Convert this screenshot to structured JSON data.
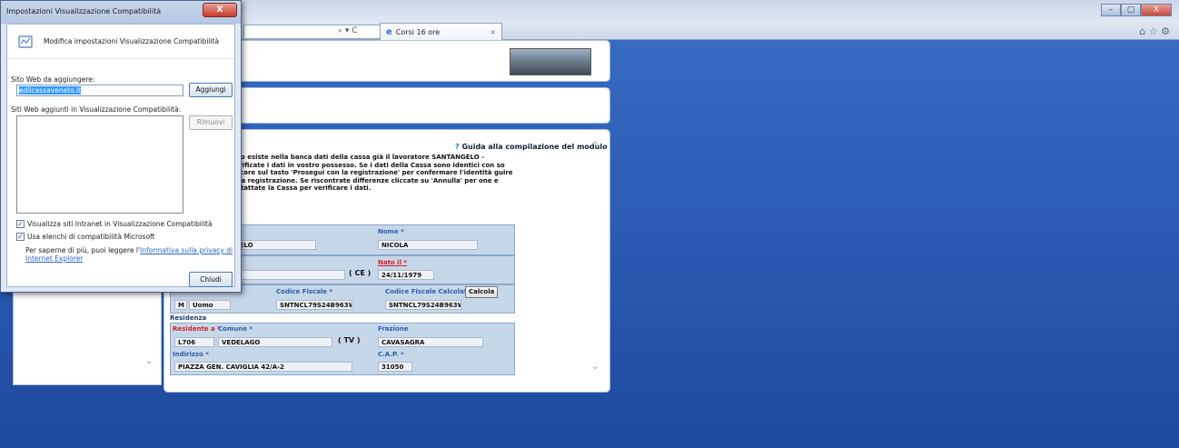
{
  "browser": {
    "tab_title": "Corsi 16 ore",
    "tab_close": "×",
    "address_tools": "⌕ ▾ C",
    "window_controls": {
      "minimize": "–",
      "maximize": "▢",
      "close": "X"
    },
    "right_icons": "⌂ ☆ ⚙"
  },
  "dialog": {
    "title": "Impostazioni Visualizzazione Compatibilità",
    "close_label": "X",
    "header_text": "Modifica impostazioni Visualizzazione Compatibilità",
    "site_to_add_label": "Sito Web da aggiungere:",
    "site_to_add_value": "edilcassaveneto.it",
    "add_button": "Aggiungi",
    "added_sites_label": "Siti Web aggiunti in Visualizzazione Compatibilità:",
    "remove_button": "Rimuovi",
    "checkbox_intranet": "Visualizza siti Intranet in Visualizzazione Compatibilità",
    "checkbox_microsoft": "Usa elenchi di compatibilità Microsoft",
    "privacy_prefix": "Per saperne di più, puoi leggere l'",
    "privacy_link": "Informativa sulla privacy di Internet Explorer",
    "close_button": "Chiudi"
  },
  "page": {
    "guide": "Guida alla compilazione del modulo",
    "message": "erito esiste nella banca dati della cassa già il lavoratore SANTANGELO - .Verificate i dati in vostro possesso. Se i dati della Cassa sono identici con so cliccare sul tasto 'Prosegui con la registrazione' per confermare l'identità guire nella registrazione. Se riscontrate differenze cliccate su 'Annulla' per one e contattate la Cassa per verificare i dati.",
    "cognome_label": "e *",
    "cognome_value": "NGELO",
    "nome_label": "Nome *",
    "nome_value": "NICOLA",
    "nato_a_label": "a *",
    "nato_a_value": "TA",
    "nato_prov": "CE",
    "nato_il_label": "Nato il *",
    "nato_il_value": "24/11/1979",
    "sesso_code": "M",
    "sesso_value": "Uomo",
    "cf_label": "Codice Fiscale *",
    "cf_value": "SNTNCL79S24B963W",
    "cf_calc_label": "Codice Fiscale Calcolato",
    "cf_calc_value": "SNTNCL79S24B963W",
    "calcola_button": "Calcola",
    "residenza_section": "Residenza",
    "residente_a_label": "Residente a *",
    "comune_label": "Comune *",
    "frazione_label": "Frazione",
    "comune_code": "L706",
    "comune_value": "VEDELAGO",
    "comune_prov": "TV",
    "frazione_value": "CAVASAGRA",
    "indirizzo_label": "Indirizzo *",
    "indirizzo_value": "PIAZZA GEN. CAVIGLIA 42/A-2",
    "cap_label": "C.A.P. *",
    "cap_value": "31050"
  }
}
